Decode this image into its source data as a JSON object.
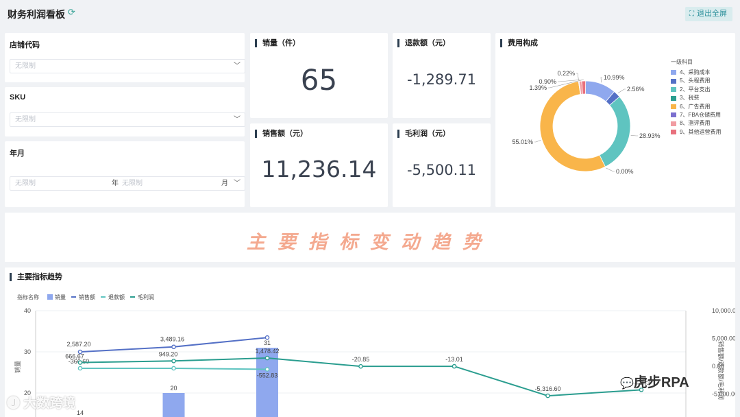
{
  "header": {
    "title": "财务利润看板",
    "refresh_icon": "refresh-icon",
    "exit_label": "退出全屏",
    "exit_icon": "compress-icon"
  },
  "filters": {
    "store": {
      "label": "店铺代码",
      "placeholder": "无限制"
    },
    "sku": {
      "label": "SKU",
      "placeholder": "无限制"
    },
    "month": {
      "label": "年月",
      "placeholder_year": "无限制",
      "year_suffix": "年",
      "placeholder_month": "无限制",
      "month_suffix": "月"
    }
  },
  "kpis": {
    "sales_qty": {
      "label": "销量（件）",
      "value": "65"
    },
    "refund": {
      "label": "退款额（元）",
      "value": "-1,289.71"
    },
    "revenue": {
      "label": "销售额（元）",
      "value": "11,236.14"
    },
    "gross_profit": {
      "label": "毛利润（元）",
      "value": "-5,500.11"
    }
  },
  "cost": {
    "title": "费用构成",
    "legend_title": "一级科目",
    "chart_data": {
      "type": "pie",
      "title": "费用构成",
      "slices": [
        {
          "name": "4、采购成本",
          "value": 10.99,
          "label": "10.99%",
          "color": "#8fa8ee"
        },
        {
          "name": "5、头程费用",
          "value": 2.56,
          "label": "2.56%",
          "color": "#5470c6"
        },
        {
          "name": "2、平台支出",
          "value": 28.93,
          "label": "28.93%",
          "color": "#5fc4c0"
        },
        {
          "name": "3、税费",
          "value": 0.0,
          "label": "0.00%",
          "color": "#2a9d8f"
        },
        {
          "name": "6、广告费用",
          "value": 55.01,
          "label": "55.01%",
          "color": "#f9b54a"
        },
        {
          "name": "7、FBA仓储费用",
          "value": 0.22,
          "label": "0.22%",
          "color": "#7b6fcf"
        },
        {
          "name": "8、测评费用",
          "value": 0.9,
          "label": "0.90%",
          "color": "#f19ca2"
        },
        {
          "name": "9、其他运营费用",
          "value": 1.39,
          "label": "1.39%",
          "color": "#e8707d"
        }
      ]
    }
  },
  "banner": {
    "text": "主要指标变动趋势"
  },
  "trend": {
    "title": "主要指标趋势",
    "legend_title": "指标名称",
    "chart_data": {
      "type": "bar",
      "title": "主要指标趋势",
      "ylabel": "销量",
      "y2label": "销售额/退款额/毛利润",
      "ylim": [
        0,
        40
      ],
      "y2lim": [
        -10000,
        10000
      ],
      "yticks": [
        "40",
        "30",
        "20"
      ],
      "y2ticks": [
        "10,000.00",
        "5,000.00",
        "0.00",
        "-5,000.00"
      ],
      "series": [
        {
          "name": "销量",
          "kind": "bar",
          "color": "#8fa8ee",
          "values": [
            14,
            20,
            31,
            null,
            null,
            null,
            null
          ]
        },
        {
          "name": "销售额",
          "kind": "line",
          "color": "#5470c6",
          "values": [
            2587.2,
            3489.16,
            5159.78,
            null,
            null,
            null,
            null
          ],
          "labels": [
            "2,587.20",
            "3,489.16",
            ""
          ]
        },
        {
          "name": "退款额",
          "kind": "line",
          "color": "#5fc4c0",
          "values": [
            -366.6,
            -366.6,
            -552.83,
            null,
            null,
            null,
            null
          ],
          "labels": [
            "-366.60",
            "",
            "-552.83"
          ]
        },
        {
          "name": "毛利润",
          "kind": "line",
          "color": "#2a9d8f",
          "values": [
            666.67,
            949.2,
            1478.42,
            -20.85,
            -13.01,
            -5316.6,
            -4243
          ],
          "labels": [
            "666.67",
            "949.20",
            "1,478.42",
            "-20.85",
            "-13.01",
            "-5,316.60",
            "-4,243"
          ]
        }
      ],
      "bar_labels": [
        "14",
        "20",
        "31"
      ]
    }
  },
  "watermarks": {
    "left": "大数跨境",
    "right": "虎步RPA"
  }
}
